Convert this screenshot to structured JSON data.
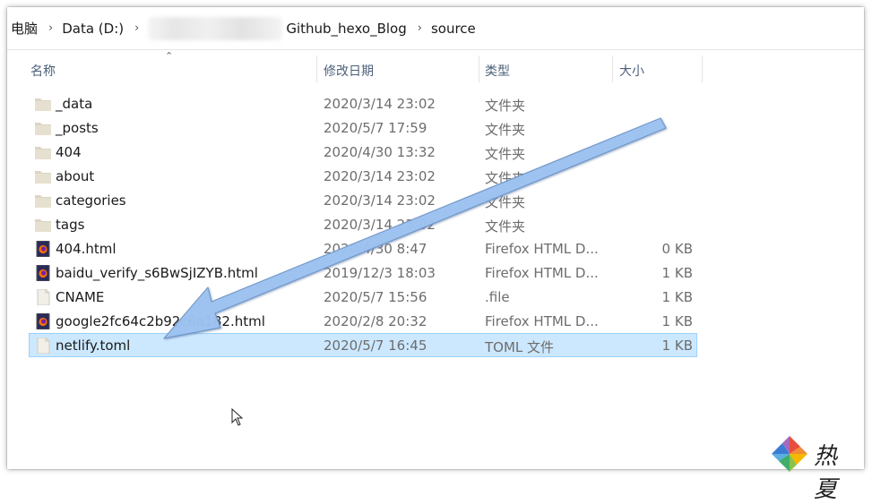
{
  "breadcrumb": {
    "items": [
      "电脑",
      "Data (D:)",
      "Github_hexo_Blog",
      "source"
    ]
  },
  "columns": {
    "name": "名称",
    "date": "修改日期",
    "type": "类型",
    "size": "大小"
  },
  "files": [
    {
      "name": "_data",
      "date": "2020/3/14 23:02",
      "type": "文件夹",
      "size": "",
      "kind": "folder-icon"
    },
    {
      "name": "_posts",
      "date": "2020/5/7 17:59",
      "type": "文件夹",
      "size": "",
      "kind": "folder-icon"
    },
    {
      "name": "404",
      "date": "2020/4/30 13:32",
      "type": "文件夹",
      "size": "",
      "kind": "folder-icon"
    },
    {
      "name": "about",
      "date": "2020/3/14 23:02",
      "type": "文件夹",
      "size": "",
      "kind": "folder-icon"
    },
    {
      "name": "categories",
      "date": "2020/3/14 23:02",
      "type": "文件夹",
      "size": "",
      "kind": "folder-icon"
    },
    {
      "name": "tags",
      "date": "2020/3/14 23:02",
      "type": "文件夹",
      "size": "",
      "kind": "folder-icon"
    },
    {
      "name": "404.html",
      "date": "2020/4/30 8:47",
      "type": "Firefox HTML D...",
      "size": "0 KB",
      "kind": "firefox-html-icon"
    },
    {
      "name": "baidu_verify_s6BwSjIZYB.html",
      "date": "2019/12/3 18:03",
      "type": "Firefox HTML D...",
      "size": "1 KB",
      "kind": "firefox-html-icon"
    },
    {
      "name": "CNAME",
      "date": "2020/5/7 15:56",
      "type": ".file",
      "size": "1 KB",
      "kind": "blank-file-icon"
    },
    {
      "name": "google2fc64c2b92c6a182.html",
      "date": "2020/2/8 20:32",
      "type": "Firefox HTML D...",
      "size": "1 KB",
      "kind": "firefox-html-icon"
    },
    {
      "name": "netlify.toml",
      "date": "2020/5/7 16:45",
      "type": "TOML 文件",
      "size": "1 KB",
      "kind": "blank-file-icon",
      "selected": true
    }
  ],
  "watermark": {
    "text": "热夏"
  },
  "colors": {
    "selection_bg": "#cce8ff",
    "selection_border": "#99d1ff",
    "arrow": "#9ec3f2",
    "folder": "#dcd5c3"
  }
}
